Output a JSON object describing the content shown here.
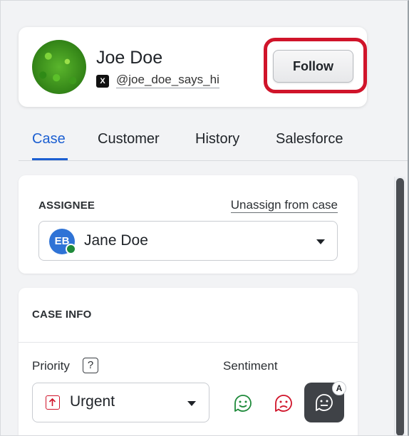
{
  "profile": {
    "name": "Joe Doe",
    "social_icon": "x-logo-icon",
    "social_icon_glyph": "X",
    "handle": "@joe_doe_says_hi",
    "follow_label": "Follow"
  },
  "tabs": [
    {
      "label": "Case",
      "active": true
    },
    {
      "label": "Customer",
      "active": false
    },
    {
      "label": "History",
      "active": false
    },
    {
      "label": "Salesforce",
      "active": false
    }
  ],
  "assignee": {
    "section_title": "ASSIGNEE",
    "unassign_label": "Unassign from case",
    "initials": "EB",
    "name": "Jane Doe",
    "status_color": "#1f8a3b"
  },
  "case_info": {
    "section_title": "CASE INFO",
    "priority_label": "Priority",
    "help_glyph": "?",
    "priority_value": "Urgent",
    "sentiment_label": "Sentiment",
    "sentiment_options": [
      "positive-face-icon",
      "negative-face-icon",
      "neutral-face-icon"
    ]
  },
  "chat_fab": {
    "badge": "A",
    "icon": "chat-bubble-face-icon"
  },
  "colors": {
    "accent": "#1c5fd1",
    "highlight": "#d0142a",
    "positive": "#1f8a3b",
    "negative": "#d0142a"
  }
}
